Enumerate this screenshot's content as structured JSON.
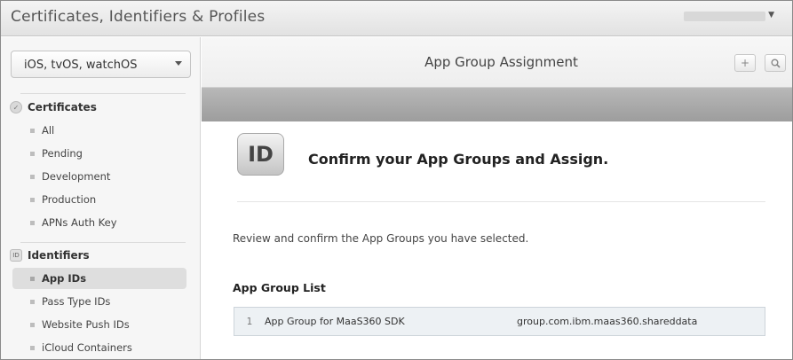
{
  "header": {
    "app_title": "Certificates, Identifiers & Profiles"
  },
  "sidebar": {
    "platform": "iOS, tvOS, watchOS",
    "sections": [
      {
        "title": "Certificates",
        "icon": "check-icon",
        "items": [
          "All",
          "Pending",
          "Development",
          "Production",
          "APNs Auth Key"
        ]
      },
      {
        "title": "Identifiers",
        "icon": "id-icon",
        "icon_text": "ID",
        "items": [
          "App IDs",
          "Pass Type IDs",
          "Website Push IDs",
          "iCloud Containers"
        ],
        "active": "App IDs"
      }
    ]
  },
  "main": {
    "title": "App Group Assignment",
    "add_symbol": "+",
    "search_symbol": "🔍",
    "badge_text": "ID",
    "heading": "Confirm your App Groups and Assign.",
    "description": "Review and confirm the App Groups you have selected.",
    "list_title": "App Group List",
    "groups": [
      {
        "index": "1",
        "name": "App Group for MaaS360 SDK",
        "identifier": "group.com.ibm.maas360.shareddata"
      }
    ]
  },
  "colors": {
    "band": "#a8a8a8",
    "row_bg": "#edf1f4"
  }
}
